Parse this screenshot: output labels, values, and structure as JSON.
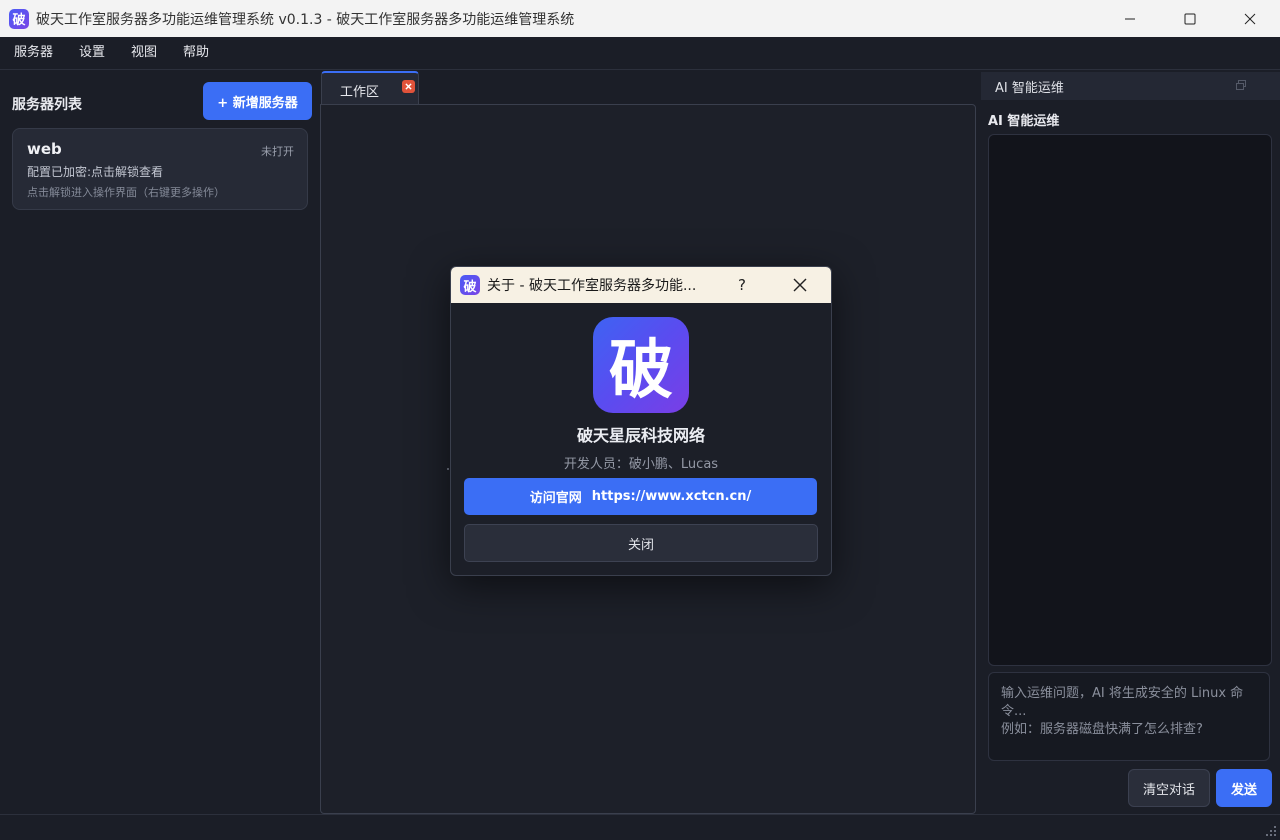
{
  "window": {
    "app_icon_glyph": "破",
    "title": "破天工作室服务器多功能运维管理系统 v0.1.3 - 破天工作室服务器多功能运维管理系统"
  },
  "menu": {
    "items": [
      {
        "label": "服务器"
      },
      {
        "label": "设置"
      },
      {
        "label": "视图"
      },
      {
        "label": "帮助"
      }
    ]
  },
  "sidebar": {
    "title": "服务器列表",
    "add_button_label": "+ 新增服务器",
    "servers": [
      {
        "name": "web",
        "status": "未打开",
        "line1": "配置已加密:点击解锁查看",
        "line2": "点击解锁进入操作界面（右键更多操作）"
      }
    ]
  },
  "workspace": {
    "tabs": [
      {
        "label": "工作区"
      }
    ],
    "partial_text_right": "。"
  },
  "ai_panel": {
    "header_title": "AI 智能运维",
    "section_title": "AI 智能运维",
    "input_placeholder": "输入运维问题，AI 将生成安全的 Linux 命令...\n例如：服务器磁盘快满了怎么排查?",
    "clear_button_label": "清空对话",
    "send_button_label": "发送"
  },
  "about_dialog": {
    "icon_glyph": "破",
    "title": "关于 - 破天工作室服务器多功能...",
    "help_label": "?",
    "logo_glyph": "破",
    "company": "破天星辰科技网络",
    "developers": "开发人员：破小鹏、Lucas",
    "visit_label": "访问官网",
    "visit_url": "https://www.xctcn.cn/",
    "close_label": "关闭"
  },
  "colors": {
    "accent": "#3b6ef5",
    "background": "#1b1e27",
    "tab_close": "#e0523a",
    "dialog_titlebar": "#f7f1e4"
  },
  "icons": {
    "minimize": "minimize-icon",
    "maximize": "maximize-icon",
    "close": "close-icon",
    "tab_close": "close-icon",
    "float": "float-window-icon",
    "resize": "resize-grip-icon"
  }
}
